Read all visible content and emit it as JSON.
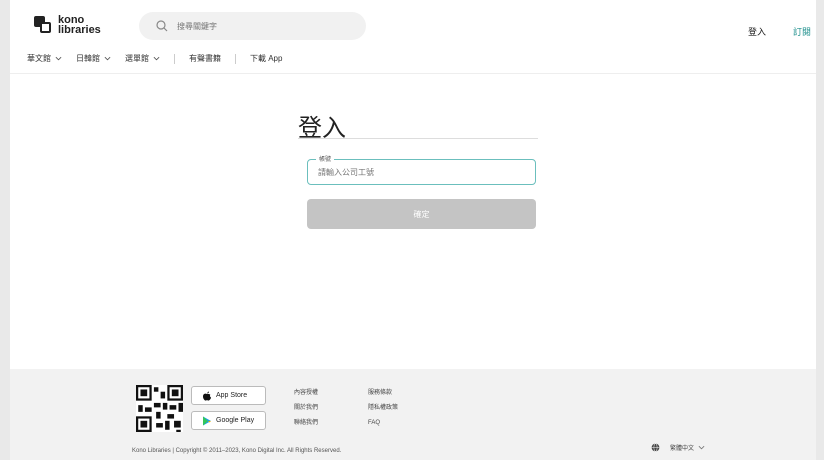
{
  "header": {
    "logo_line1": "kono",
    "logo_line2": "libraries",
    "search_placeholder": "搜尋關鍵字",
    "login_label": "登入",
    "subscribe_label": "訂閱"
  },
  "nav": {
    "items": [
      {
        "label": "華文館",
        "has_dropdown": true
      },
      {
        "label": "日韓館",
        "has_dropdown": true
      },
      {
        "label": "選單館",
        "has_dropdown": true
      }
    ],
    "links": [
      "有聲書籍",
      "下載 App"
    ]
  },
  "login": {
    "title": "登入",
    "field_label": "帳號",
    "field_placeholder": "請輸入公司工號",
    "field_value": "",
    "submit_label": "確定"
  },
  "footer": {
    "app_store_label": "App Store",
    "google_play_label": "Google Play",
    "links_col1": [
      "內容授權",
      "關於我們",
      "聯絡我們"
    ],
    "links_col2": [
      "服務條款",
      "隱私權政策",
      "FAQ"
    ],
    "copyright": "Kono Libraries | Copyright © 2011–2023, Kono Digital Inc. All Rights Reserved.",
    "language": "繁體中文"
  },
  "colors": {
    "accent": "#1e8f8c",
    "field_border": "#6bbfbd",
    "button_disabled": "#c4c4c4"
  }
}
